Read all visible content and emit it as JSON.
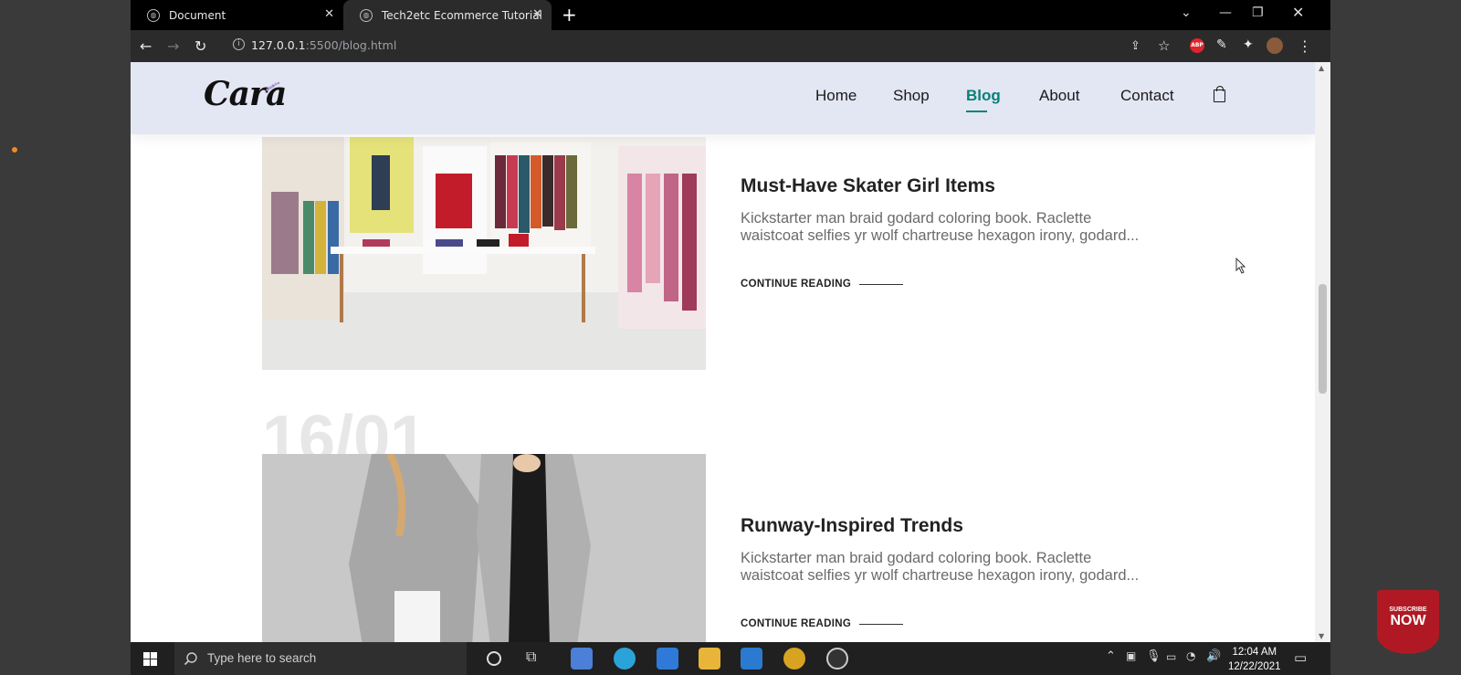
{
  "browser": {
    "tabs": [
      {
        "title": "Document",
        "active": false
      },
      {
        "title": "Tech2etc Ecommerce Tutorial",
        "active": true
      }
    ],
    "url_host": "127.0.0.1",
    "url_path": ":5500/blog.html",
    "extension_abp": "ABP"
  },
  "site": {
    "logo": "Cara",
    "nav": [
      {
        "label": "Home",
        "active": false
      },
      {
        "label": "Shop",
        "active": false
      },
      {
        "label": "Blog",
        "active": true
      },
      {
        "label": "About",
        "active": false
      },
      {
        "label": "Contact",
        "active": false
      }
    ],
    "accent_color": "#088178",
    "header_bg": "#e3e6f3"
  },
  "posts": [
    {
      "title": "Must-Have Skater Girl Items",
      "excerpt": "Kickstarter man braid godard coloring book. Raclette waistcoat selfies yr wolf chartreuse hexagon irony, godard...",
      "cta": "CONTINUE READING"
    },
    {
      "date": "16/01",
      "title": "Runway-Inspired Trends",
      "excerpt": "Kickstarter man braid godard coloring book. Raclette waistcoat selfies yr wolf chartreuse hexagon irony, godard...",
      "cta": "CONTINUE READING"
    }
  ],
  "taskbar": {
    "search_placeholder": "Type here to search",
    "time": "12:04 AM",
    "date": "12/22/2021"
  },
  "overlay": {
    "subscribe_line1": "SUBSCRIBE",
    "subscribe_line2": "NOW"
  }
}
